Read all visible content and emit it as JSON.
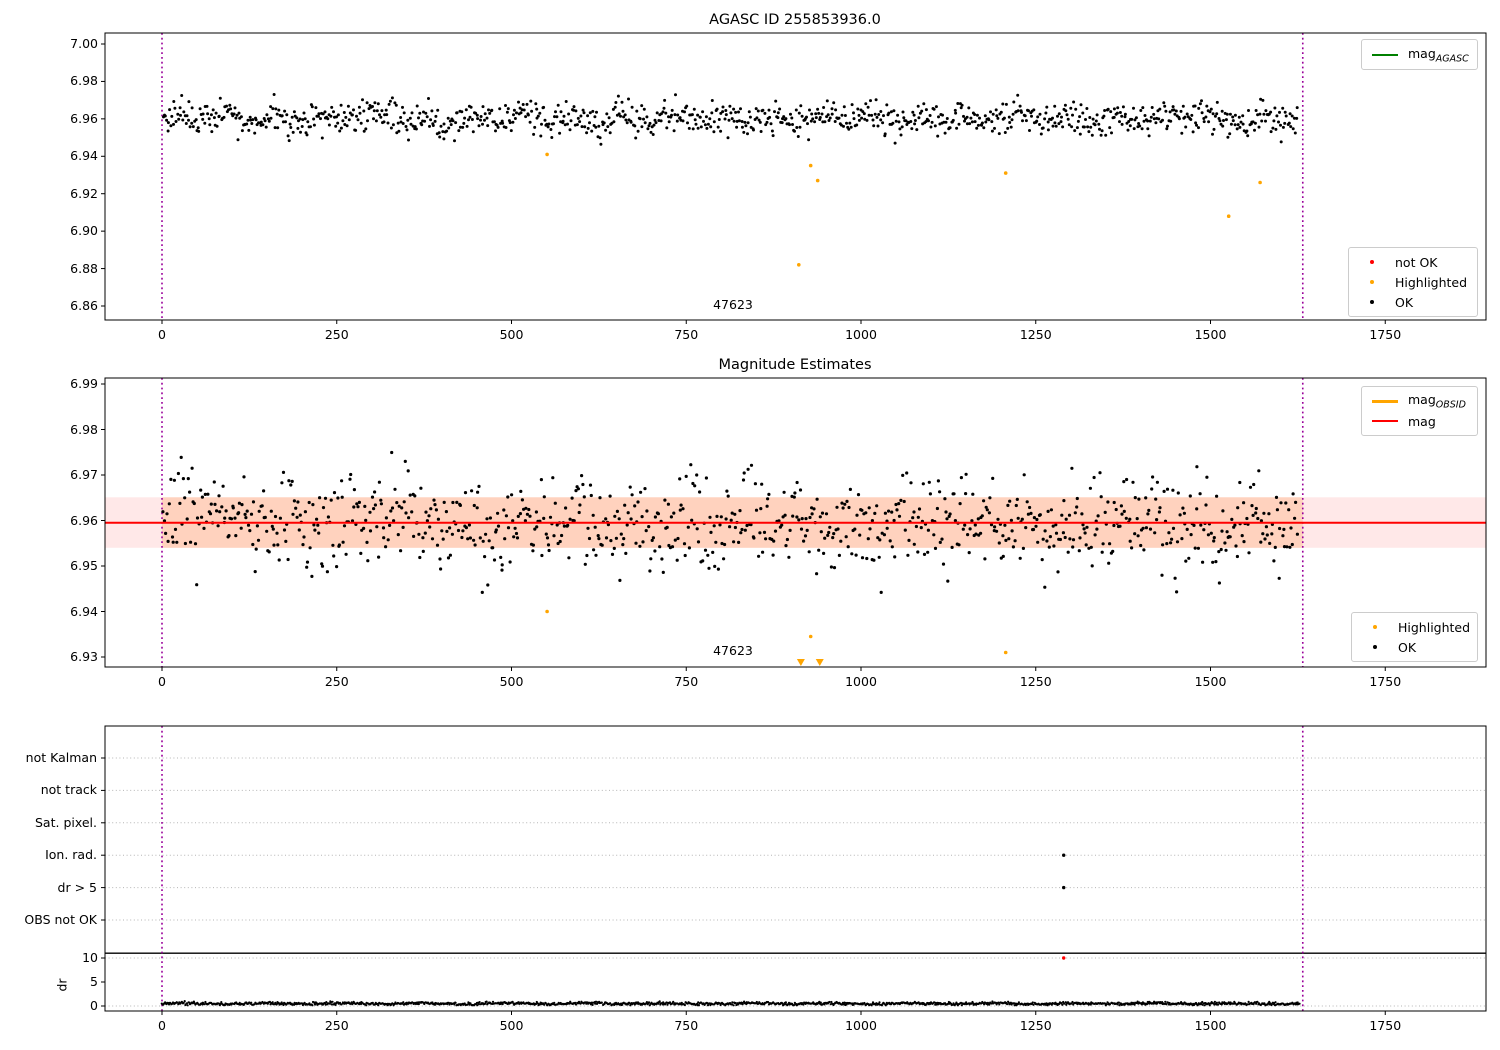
{
  "figure_title": "AGASC ID 255853936.0",
  "obsid_annotation": "47623",
  "colors": {
    "ok": "#000000",
    "not_ok": "#ff0000",
    "highlighted": "#ffa500",
    "mag_line": "#ff0000",
    "mag_agasc_line": "#008000",
    "mag_obsid_line": "#ffa500",
    "mag_band": "rgba(255,0,0,0.09)",
    "obsid_band": "rgba(255,130,40,0.22)",
    "vline": "#990099",
    "grid": "#b5b5b5",
    "threshold_line": "#000000"
  },
  "legends": {
    "agasc": {
      "main": "mag",
      "sub": "AGASC"
    },
    "obsid": {
      "main": "mag",
      "sub": "OBSID"
    },
    "mag": {
      "label": "mag"
    },
    "not_ok": {
      "label": "not OK"
    },
    "highlighted": {
      "label": "Highlighted"
    },
    "ok": {
      "label": "OK"
    }
  },
  "chart_data": [
    {
      "id": "agasc_plot",
      "type": "scatter",
      "title": "AGASC ID 255853936.0",
      "xticks": [
        "0",
        "250",
        "500",
        "750",
        "1000",
        "1250",
        "1500",
        "1750"
      ],
      "xtick_values": [
        0,
        250,
        500,
        750,
        1000,
        1250,
        1500,
        1750
      ],
      "yticks": [
        "7.00",
        "6.98",
        "6.96",
        "6.94",
        "6.92",
        "6.90",
        "6.88",
        "6.86"
      ],
      "ytick_values": [
        7.0,
        6.98,
        6.96,
        6.94,
        6.92,
        6.9,
        6.88,
        6.86
      ],
      "ylim": [
        6.8525,
        7.0059
      ],
      "xlim": [
        -82,
        1894
      ],
      "vlines": [
        0,
        1632
      ],
      "ok_series": {
        "n": 1050,
        "x_range": [
          2,
          1626
        ],
        "y_mean": 6.96,
        "y_sigma": 0.0042,
        "y_clip": [
          6.9455,
          6.9755
        ],
        "seed": 42
      },
      "highlighted_points": [
        [
          551,
          6.941
        ],
        [
          911,
          6.882
        ],
        [
          928,
          6.935
        ],
        [
          938,
          6.927
        ],
        [
          1207,
          6.931
        ],
        [
          1526,
          6.908
        ],
        [
          1571,
          6.926
        ]
      ],
      "not_ok_points": [],
      "annotation": {
        "text": "47623",
        "x": 817,
        "y": 6.861
      }
    },
    {
      "id": "magnitude_estimates_plot",
      "type": "scatter",
      "title": "Magnitude Estimates",
      "xticks": [
        "0",
        "250",
        "500",
        "750",
        "1000",
        "1250",
        "1500",
        "1750"
      ],
      "xtick_values": [
        0,
        250,
        500,
        750,
        1000,
        1250,
        1500,
        1750
      ],
      "yticks": [
        "6.99",
        "6.98",
        "6.97",
        "6.96",
        "6.95",
        "6.94",
        "6.93"
      ],
      "ytick_values": [
        6.99,
        6.98,
        6.97,
        6.96,
        6.95,
        6.94,
        6.93
      ],
      "ylim": [
        6.9278,
        6.9913
      ],
      "xlim": [
        -82,
        1894
      ],
      "vlines": [
        0,
        1632
      ],
      "mag_line_value": 6.9595,
      "mag_band": {
        "min": 6.954,
        "max": 6.9651
      },
      "obsid_band": {
        "min": 6.954,
        "max": 6.9651,
        "x_range": [
          0,
          1632
        ]
      },
      "ok_series": {
        "n": 920,
        "x_range": [
          2,
          1626
        ],
        "y_mean": 6.9597,
        "y_sigma": 0.005,
        "y_clip": [
          6.9442,
          6.9758
        ],
        "seed": 7
      },
      "highlighted_points": [
        [
          551,
          6.94
        ],
        [
          928,
          6.9345
        ],
        [
          1207,
          6.931
        ]
      ],
      "clipped_highlighted_x": [
        914,
        941
      ],
      "annotation": {
        "text": "47623",
        "x": 817,
        "y": 6.9315
      }
    },
    {
      "id": "flags_dr_plot",
      "type": "scatter",
      "categories": [
        "not Kalman",
        "not track",
        "Sat. pixel.",
        "Ion. rad.",
        "dr > 5",
        "OBS not OK"
      ],
      "flag_points": [
        {
          "x": 1290,
          "category": "Ion. rad."
        },
        {
          "x": 1290,
          "category": "dr > 5"
        }
      ],
      "dr_axis": {
        "label": "dr",
        "ticks": [
          "10",
          "5",
          "0"
        ],
        "tick_values": [
          10,
          5,
          0
        ],
        "threshold_value": 11,
        "red_point": {
          "x": 1290,
          "value": 10
        },
        "ok_series": {
          "n": 1500,
          "x_range": [
            0,
            1628
          ],
          "mean": 0.5,
          "sigma": 0.16,
          "clip": [
            0.15,
            1.05
          ],
          "seed": 99
        }
      },
      "xticks": [
        "0",
        "250",
        "500",
        "750",
        "1000",
        "1250",
        "1500",
        "1750"
      ],
      "xtick_values": [
        0,
        250,
        500,
        750,
        1000,
        1250,
        1500,
        1750
      ],
      "vlines": [
        0,
        1632
      ]
    }
  ]
}
